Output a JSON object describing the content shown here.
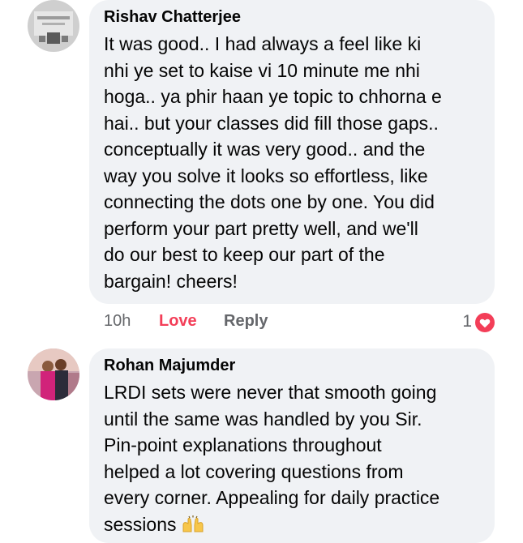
{
  "comments": [
    {
      "author": "Rishav Chatterjee",
      "lines": [
        "It was good.. I had always a feel like ki",
        "nhi ye set to kaise vi 10 minute me nhi",
        "hoga.. ya phir haan ye topic to chhorna e",
        "hai.. but your classes did fill those gaps..",
        "conceptually it was very good.. and the",
        "way you solve it looks so effortless, like",
        "connecting the dots one by one. You did",
        "perform your part pretty well, and we'll",
        "do our best to keep our part of the",
        "bargain! cheers!"
      ],
      "time": "10h",
      "love_label": "Love",
      "reply_label": "Reply",
      "reaction_count": "1",
      "reaction_icon": "heart-icon",
      "love_color": "#f33e58"
    },
    {
      "author": "Rohan Majumder",
      "lines": [
        "LRDI sets were never that smooth going",
        "until the same was handled by you Sir.",
        "Pin-point explanations throughout",
        "helped a lot covering questions from",
        "every corner. Appealing for daily practice",
        "sessions"
      ],
      "emoji": "raising-hands-emoji"
    }
  ],
  "colors": {
    "bubble": "#f0f2f5",
    "text": "#050505",
    "muted": "#65676b"
  }
}
